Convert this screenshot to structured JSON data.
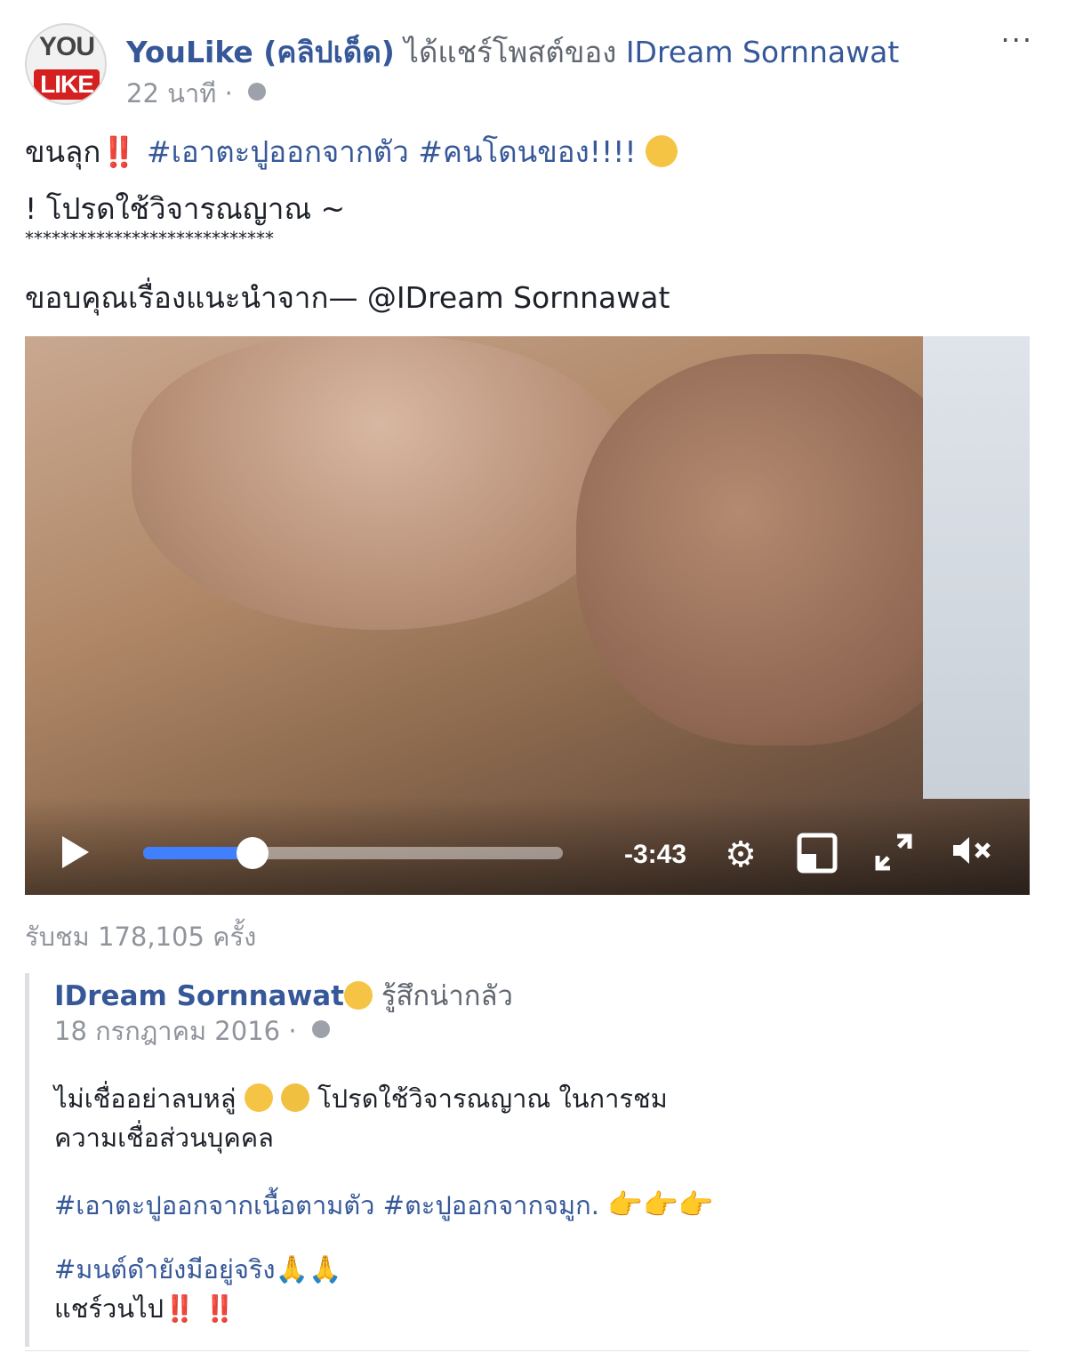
{
  "post": {
    "page_name": "YouLike (คลิปเด็ด)",
    "shared_text": "ได้แชร์โพสต์ของ",
    "shared_target": "IDream Sornnawat",
    "time": "22 นาที",
    "time_separator": "·",
    "more": "···",
    "avatar_top": "YOU",
    "avatar_bottom": "LIKE",
    "line1_a": "ขนลุก",
    "line1_bang": "‼️",
    "line1_hash": "#เอาตะปูออกจากตัว #คนโดนของ!!!!",
    "line2": "! โปรดใช้วิจารณญาณ ~",
    "line3": "****************************",
    "line4": "ขอบคุณเรื่องแนะนำจาก— @IDream Sornnawat"
  },
  "video": {
    "time_remaining": "-3:43",
    "progress": 0.26
  },
  "views": "รับชม 178,105 ครั้ง",
  "shared": {
    "author": "IDream Sornnawat",
    "feeling": "รู้สึกน่ากลัว",
    "date": "18 กรกฎาคม 2016",
    "date_separator": "·",
    "text1": "ไม่เชื่ออย่าลบหลู่",
    "text1b": "โปรดใช้วิจารณญาณ ในการชม",
    "text2": "ความเชื่อส่วนบุคคล",
    "text3": "#เอาตะปูออกจากเนื้อตามตัว #ตะปูออกจากจมูก.",
    "text4": "#มนต์ดำยังมีอยู่จริง",
    "text5": "แชร์วนไป",
    "bang": "‼️"
  },
  "colors": {
    "link": "#365899",
    "progress": "#4080ff",
    "bang": "#e02020"
  }
}
